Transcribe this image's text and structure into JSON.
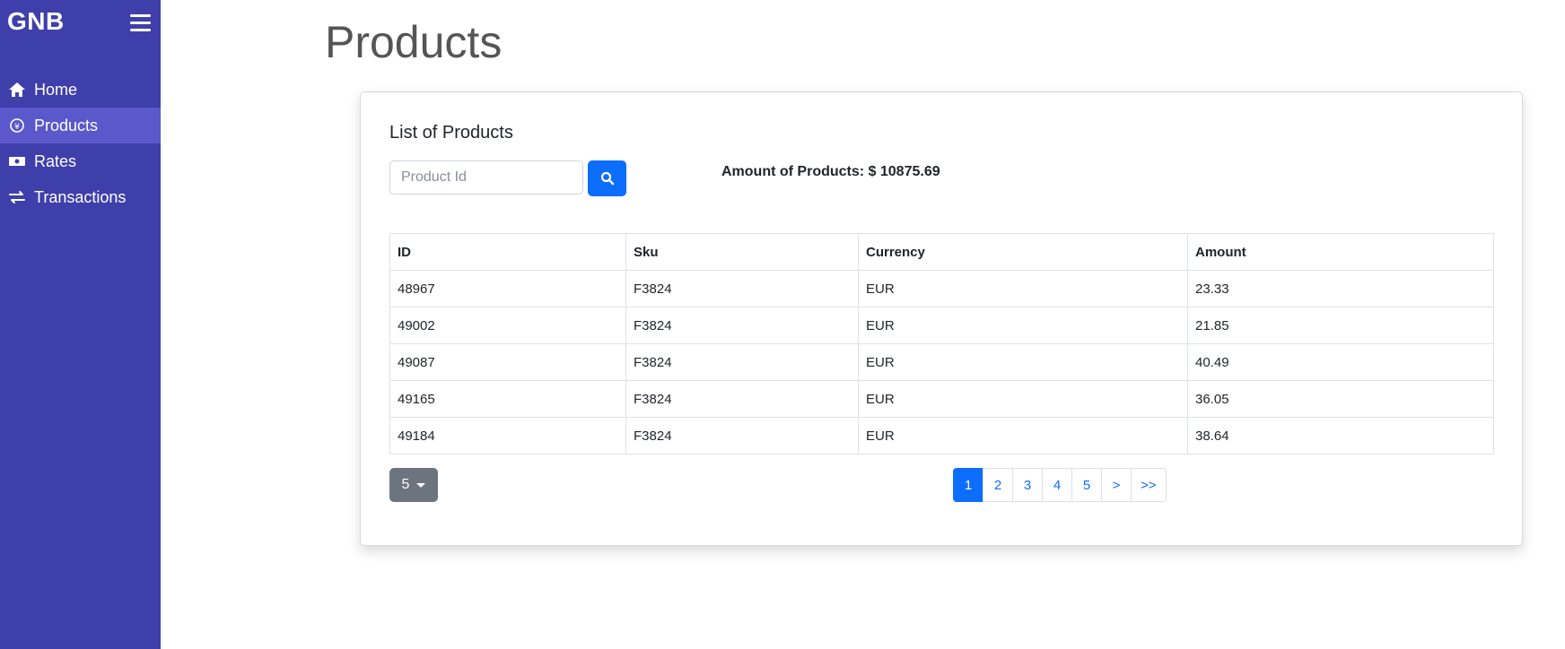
{
  "sidebar": {
    "brand": "GNB",
    "items": [
      {
        "label": "Home",
        "icon": "home-icon"
      },
      {
        "label": "Products",
        "icon": "product-icon"
      },
      {
        "label": "Rates",
        "icon": "money-icon"
      },
      {
        "label": "Transactions",
        "icon": "exchange-icon"
      }
    ],
    "active_item": "Products"
  },
  "page": {
    "title": "Products"
  },
  "card": {
    "title": "List of Products",
    "search_placeholder": "Product Id",
    "amount_label": "Amount of Products: $ 10875.69"
  },
  "table": {
    "headers": [
      "ID",
      "Sku",
      "Currency",
      "Amount"
    ],
    "rows": [
      [
        "48967",
        "F3824",
        "EUR",
        "23.33"
      ],
      [
        "49002",
        "F3824",
        "EUR",
        "21.85"
      ],
      [
        "49087",
        "F3824",
        "EUR",
        "40.49"
      ],
      [
        "49165",
        "F3824",
        "EUR",
        "36.05"
      ],
      [
        "49184",
        "F3824",
        "EUR",
        "38.64"
      ]
    ]
  },
  "pagination": {
    "page_size": "5",
    "pages": [
      "1",
      "2",
      "3",
      "4",
      "5",
      ">",
      ">>"
    ],
    "active_page": "1"
  },
  "colors": {
    "sidebar_bg": "#3f3fab",
    "sidebar_active": "#5b58cc",
    "primary": "#0d6efd",
    "secondary": "#6c757d"
  }
}
